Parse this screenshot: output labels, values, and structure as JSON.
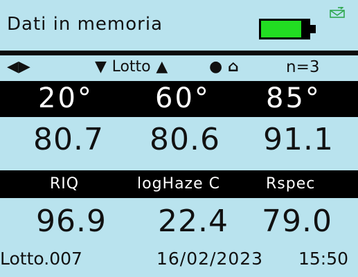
{
  "header": {
    "title": "Dati in memoria",
    "battery_level": 0.85,
    "battery_color": "#22dd22",
    "status_icon": "mail-outbox-icon",
    "status_icon_color": "#2fa84f"
  },
  "nav": {
    "arrows": "◀▶",
    "down_arrow": "▼",
    "lotto_label": "Lotto",
    "up_arrow": "▲",
    "dot": "●",
    "home_icon": "⌂",
    "count": "n=3"
  },
  "angles": [
    "20°",
    "60°",
    "85°"
  ],
  "gloss_values": [
    "80.7",
    "80.6",
    "91.1"
  ],
  "metric_labels": [
    "RIQ",
    "logHaze C",
    "Rspec"
  ],
  "metric_values": [
    "96.9",
    "22.4",
    "79.0"
  ],
  "footer": {
    "lot": "Lotto.007",
    "date": "16/02/2023",
    "time": "15:50"
  },
  "colors": {
    "background": "#b9e3ee",
    "bars": "#000000",
    "bar_text": "#ffffff"
  }
}
